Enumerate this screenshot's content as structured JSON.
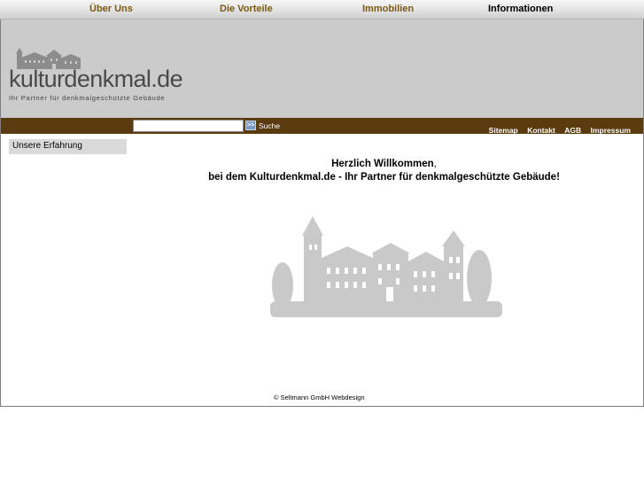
{
  "top_nav": {
    "items": [
      {
        "label": "Über Uns"
      },
      {
        "label": "Die Vorteile"
      },
      {
        "label": "Immobilien"
      },
      {
        "label": "Informationen"
      }
    ],
    "active_index": 3
  },
  "header": {
    "logo_title": "kulturdenkmal.de",
    "logo_tagline": "Ihr Partner für denkmalgeschützte Gebäude",
    "background_color": "#cbcbcb"
  },
  "toolbar": {
    "background_color": "#5a3a0f",
    "search": {
      "value": "",
      "placeholder": "",
      "go_label": ">>",
      "label": "Suche"
    },
    "links": [
      {
        "label": "Sitemap"
      },
      {
        "label": "Kontakt"
      },
      {
        "label": "AGB"
      },
      {
        "label": "Impressum"
      }
    ]
  },
  "sidebar": {
    "items": [
      {
        "label": "Unsere Erfahrung"
      }
    ]
  },
  "main": {
    "welcome_line1": "Herzlich Willkommen",
    "welcome_comma": ",",
    "welcome_line2": "bei dem Kulturdenkmal.de - Ihr Partner für denkmalgeschützte Gebäude!"
  },
  "footer": {
    "copyright": "© Seltmann GmbH Webdesign"
  },
  "icons": {
    "logo_castle": "castle-icon",
    "illustration": "castle-illustration"
  }
}
